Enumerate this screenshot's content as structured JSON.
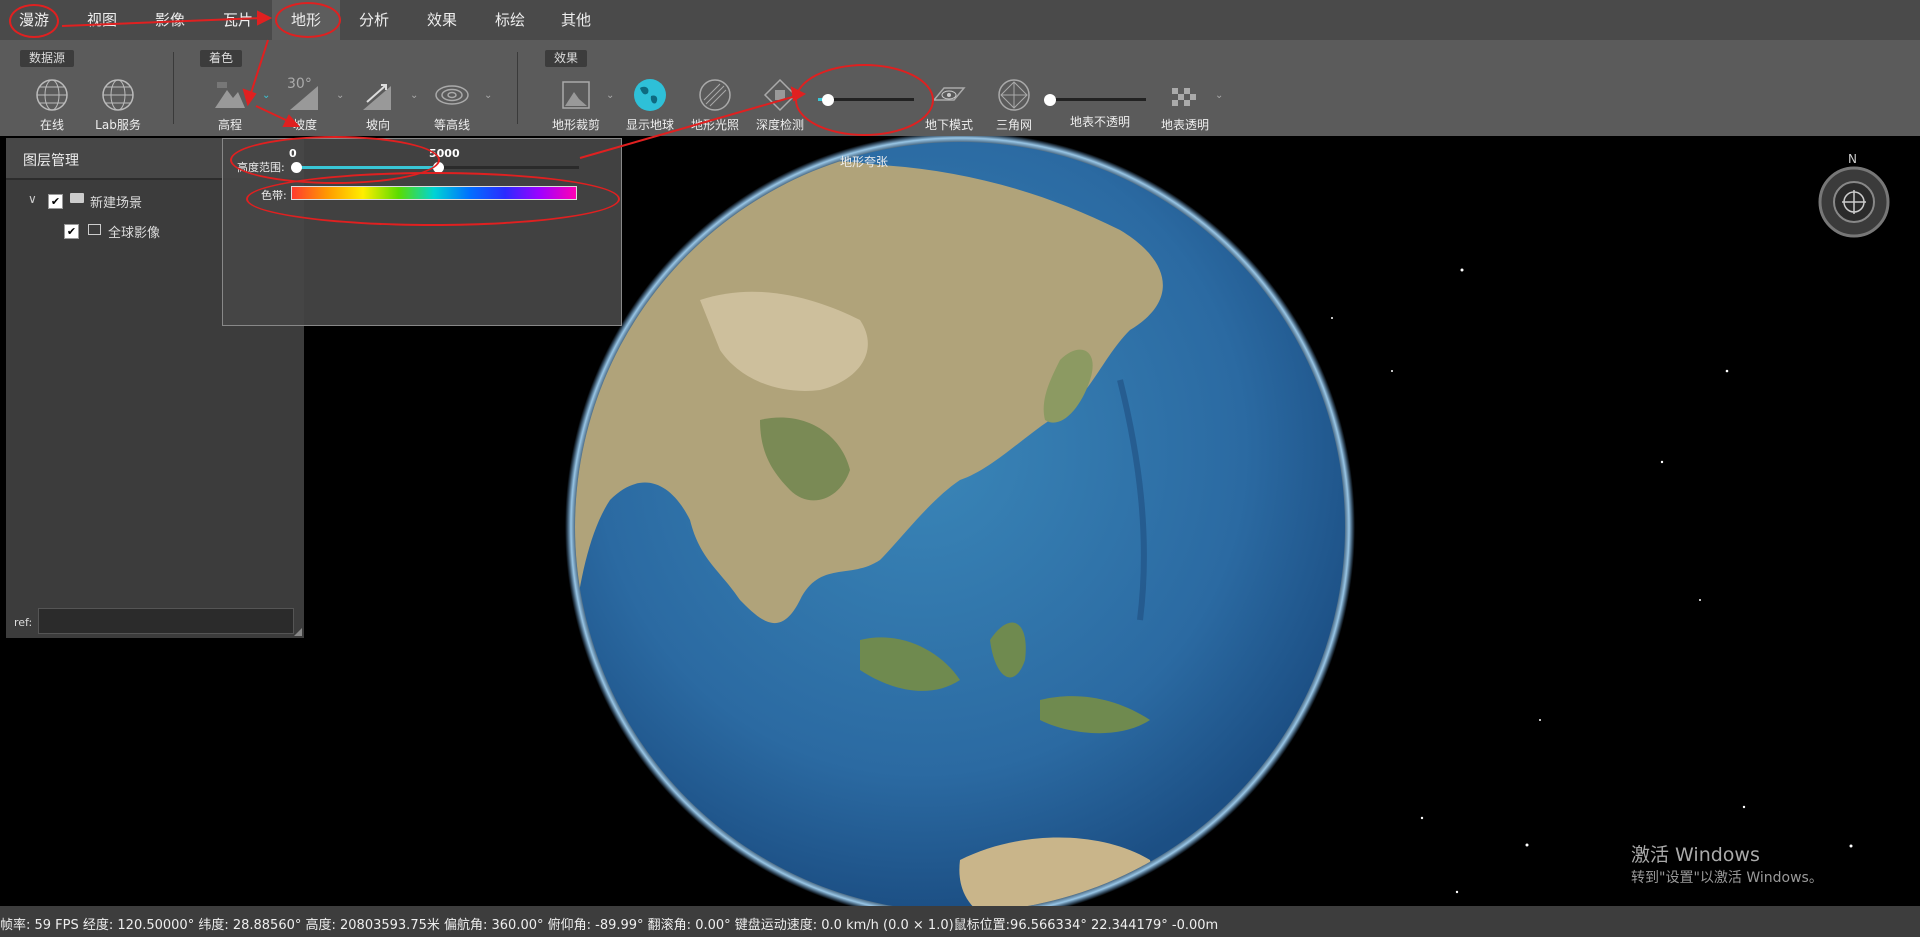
{
  "menu": {
    "items": [
      "漫游",
      "视图",
      "影像",
      "瓦片",
      "地形",
      "分析",
      "效果",
      "标绘",
      "其他"
    ],
    "active": "地形"
  },
  "ribbon": {
    "groups": {
      "datasource": "数据源",
      "coloring": "着色",
      "effects": "效果"
    },
    "tools": {
      "online": "在线",
      "lab_service": "Lab服务",
      "elevation": "高程",
      "slope": "坡度",
      "slope_badge": "30°",
      "aspect": "坡向",
      "contour": "等高线",
      "terrain_clip": "地形裁剪",
      "show_globe": "显示地球",
      "terrain_light": "地形光照",
      "depth_detect": "深度检测",
      "terrain_exaggeration": "地形夸张",
      "underground": "地下模式",
      "triangle_mesh": "三角网",
      "surface_opacity": "地表不透明",
      "surface_transparent": "地表透明"
    },
    "sliders": {
      "terrain_exaggeration_level": 0.1,
      "surface_opacity_level": 0.0
    }
  },
  "layer_panel": {
    "title": "图层管理",
    "items": [
      "新建场景",
      "全球影像"
    ],
    "ref_label": "ref:"
  },
  "elevation_popup": {
    "range_label": "高度范围:",
    "range_min": "0",
    "range_max": "5000",
    "color_label": "色带:"
  },
  "compass": {
    "north": "N"
  },
  "status_bar": {
    "text": "帧率: 59 FPS 经度: 120.50000° 纬度: 28.88560° 高度: 20803593.75米 偏航角: 360.00° 俯仰角: -89.99° 翻滚角: 0.00° 键盘运动速度: 0.0 km/h (0.0 × 1.0)鼠标位置:96.566334° 22.344179° -0.00m"
  },
  "watermark": {
    "line1": "激活 Windows",
    "line2": "转到\"设置\"以激活 Windows。"
  },
  "colors": {
    "accent": "#39c6d6",
    "annotation": "#e02020",
    "ocean": "#2f6fa6",
    "land": "#a9a27c"
  }
}
